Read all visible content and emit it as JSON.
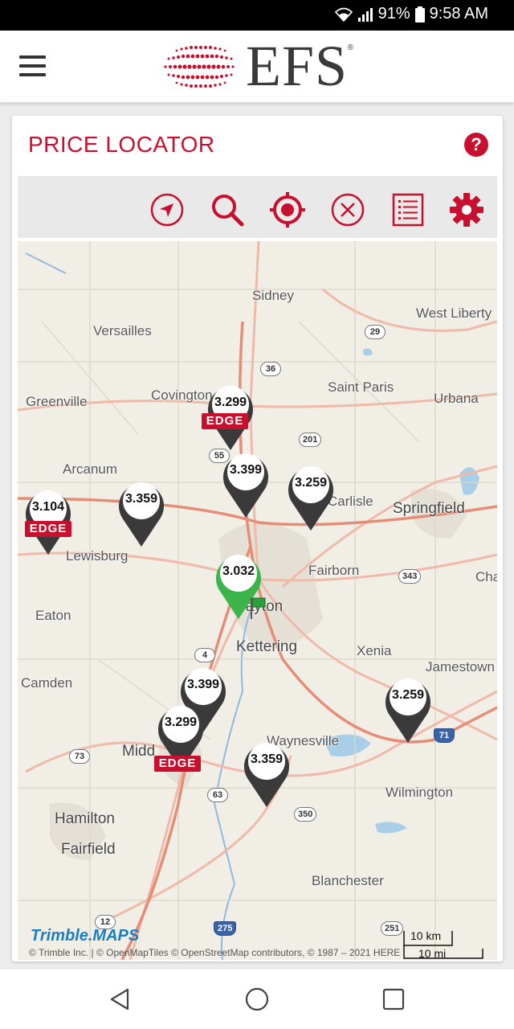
{
  "status": {
    "battery": "91%",
    "time": "9:58 AM"
  },
  "brand": {
    "logo": "EFS",
    "reg": "®"
  },
  "page": {
    "title": "PRICE LOCATOR",
    "help": "?"
  },
  "toolbar": {
    "tools": [
      "navigate-icon",
      "search-icon",
      "locate-icon",
      "clear-icon",
      "list-icon",
      "settings-icon"
    ]
  },
  "map": {
    "places": {
      "sidney": "Sidney",
      "west_liberty": "West Liberty",
      "versailles": "Versailles",
      "saint_paris": "Saint Paris",
      "greenville": "Greenville",
      "covington": "Covington",
      "urbana": "Urbana",
      "arcanum": "Arcanum",
      "carlisle": "Carlisle",
      "springfield": "Springfield",
      "lewisburg": "Lewisburg",
      "fairborn": "Fairborn",
      "cha": "Cha",
      "eaton": "Eaton",
      "dayton": "Dayton",
      "kettering": "Kettering",
      "xenia": "Xenia",
      "jamestown": "Jamestown",
      "camden": "Camden",
      "middletown": "Midd",
      "waynesville": "Waynesville",
      "wilmington": "Wilmington",
      "hamilton": "Hamilton",
      "fairfield": "Fairfield",
      "blanchester": "Blanchester"
    },
    "routes": [
      "29",
      "36",
      "201",
      "55",
      "343",
      "4",
      "73",
      "71",
      "63",
      "350",
      "251",
      "275",
      "12"
    ],
    "pins": {
      "p1": "3.299",
      "p2": "3.399",
      "p3": "3.259",
      "p4": "3.359",
      "p5": "3.104",
      "p6": "3.032",
      "p7": "3.399",
      "p8": "3.299",
      "p9": "3.359",
      "p10": "3.259"
    },
    "badges": {
      "b1": "EDGE",
      "b2": "EDGE",
      "b3": "EDGE"
    },
    "attribution": "© Trimble Inc. | © OpenMapTiles © OpenStreetMap contributors, © 1987 – 2021 HERE",
    "provider": "Trimble.MAPS",
    "scale_km": "10 km",
    "scale_mi": "10 mi"
  },
  "colors": {
    "accent": "#c8102e",
    "pin_selected": "#3bb54a"
  }
}
